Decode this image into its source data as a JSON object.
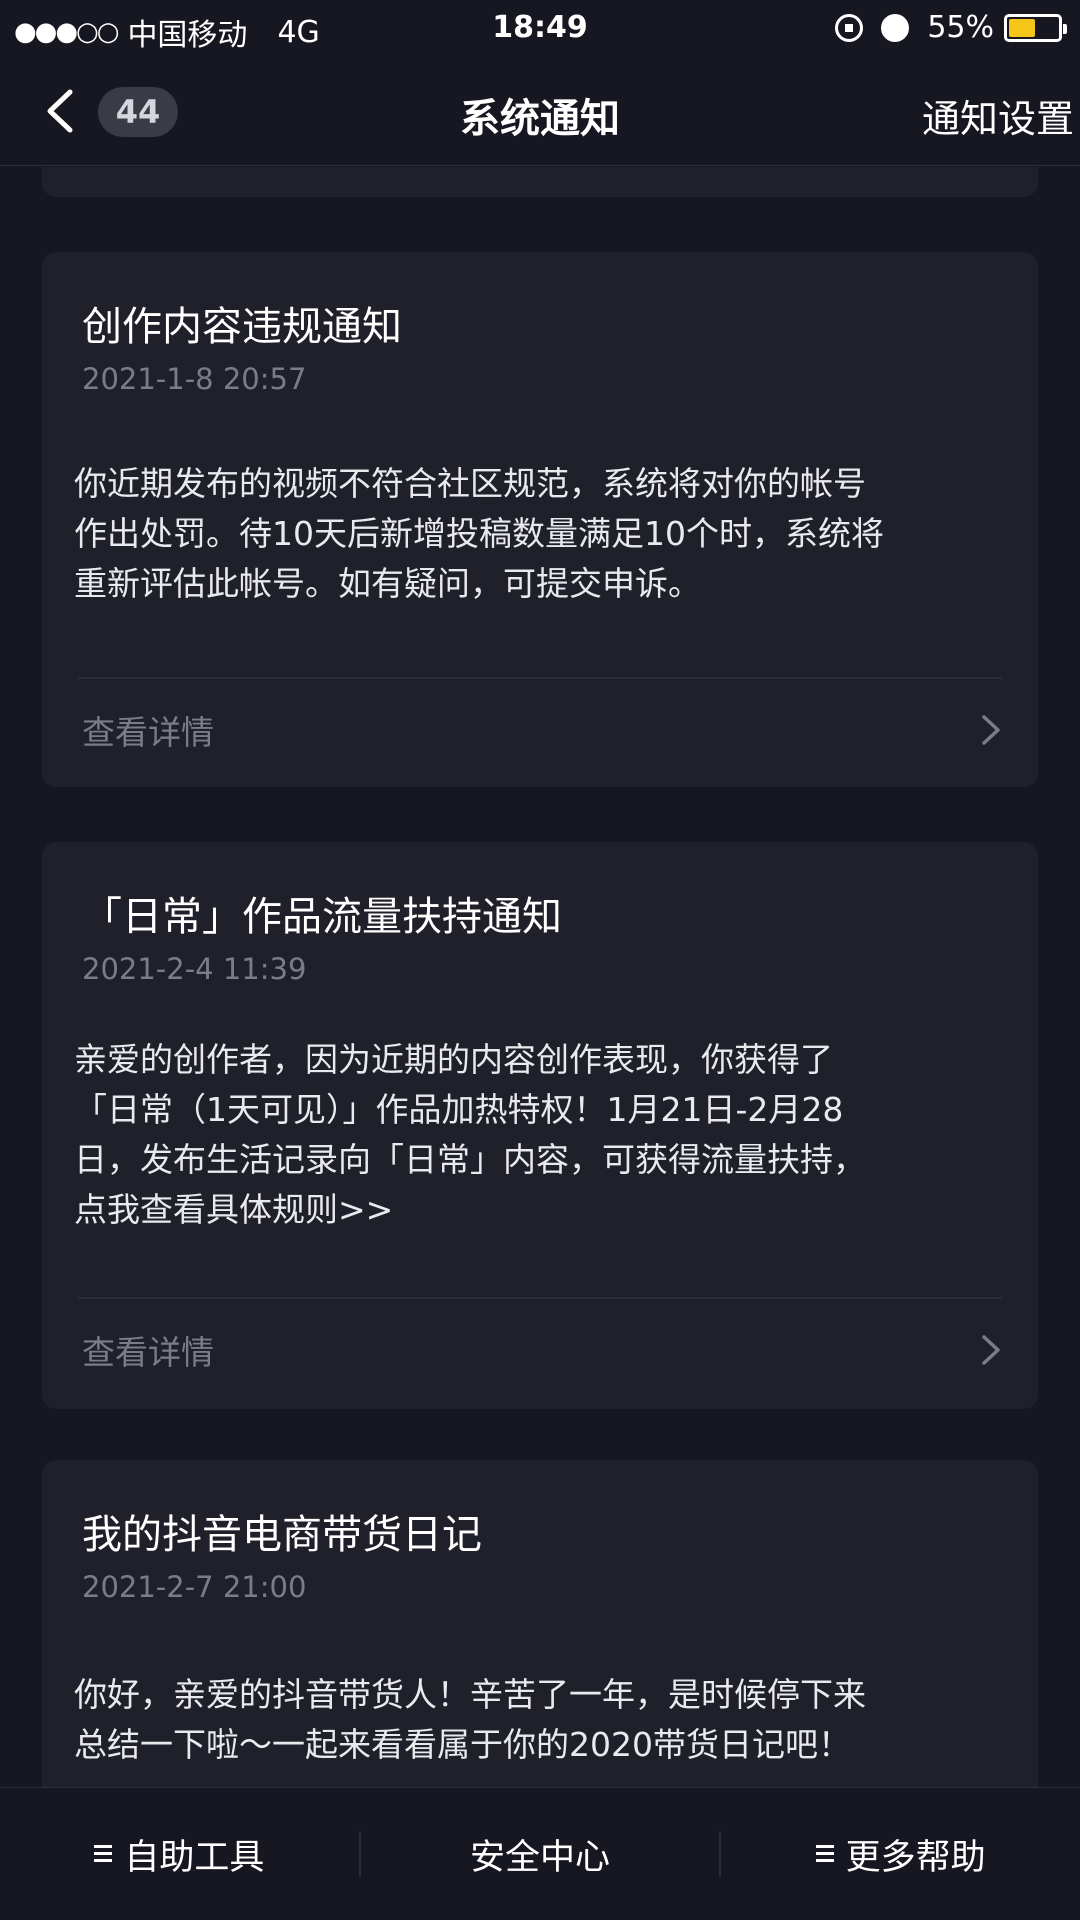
{
  "status_bar": {
    "signal": "●●●○○",
    "carrier": "中国移动",
    "network": "4G",
    "time": "18:49",
    "battery_percent": "55%",
    "battery_level": 0.55,
    "battery_color": "#f5c518"
  },
  "nav": {
    "back_icon": "chevron-left-icon",
    "unread_count": "44",
    "title": "系统通知",
    "settings_label": "通知设置"
  },
  "notifications": [
    {
      "title": "创作内容违规通知",
      "time": "2021-1-8 20:57",
      "body": "你近期发布的视频不符合社区规范，系统将对你的帐号\n作出处罚。待10天后新增投稿数量满足10个时，系统将\n重新评估此帐号。如有疑问，可提交申诉。",
      "details_label": "查看详情"
    },
    {
      "title": "「日常」作品流量扶持通知",
      "time": "2021-2-4 11:39",
      "body": "亲爱的创作者，因为近期的内容创作表现，你获得了\n「日常（1天可见）」作品加热特权！1月21日-2月28\n日，发布生活记录向「日常」内容，可获得流量扶持，\n点我查看具体规则>>",
      "details_label": "查看详情"
    },
    {
      "title": "我的抖音电商带货日记",
      "time": "2021-2-7 21:00",
      "body": "你好，亲爱的抖音带货人！辛苦了一年，是时候停下来\n总结一下啦～一起来看看属于你的2020带货日记吧！"
    }
  ],
  "bottom_bar": {
    "self_help": "自助工具",
    "security_center": "安全中心",
    "more_help": "更多帮助"
  }
}
